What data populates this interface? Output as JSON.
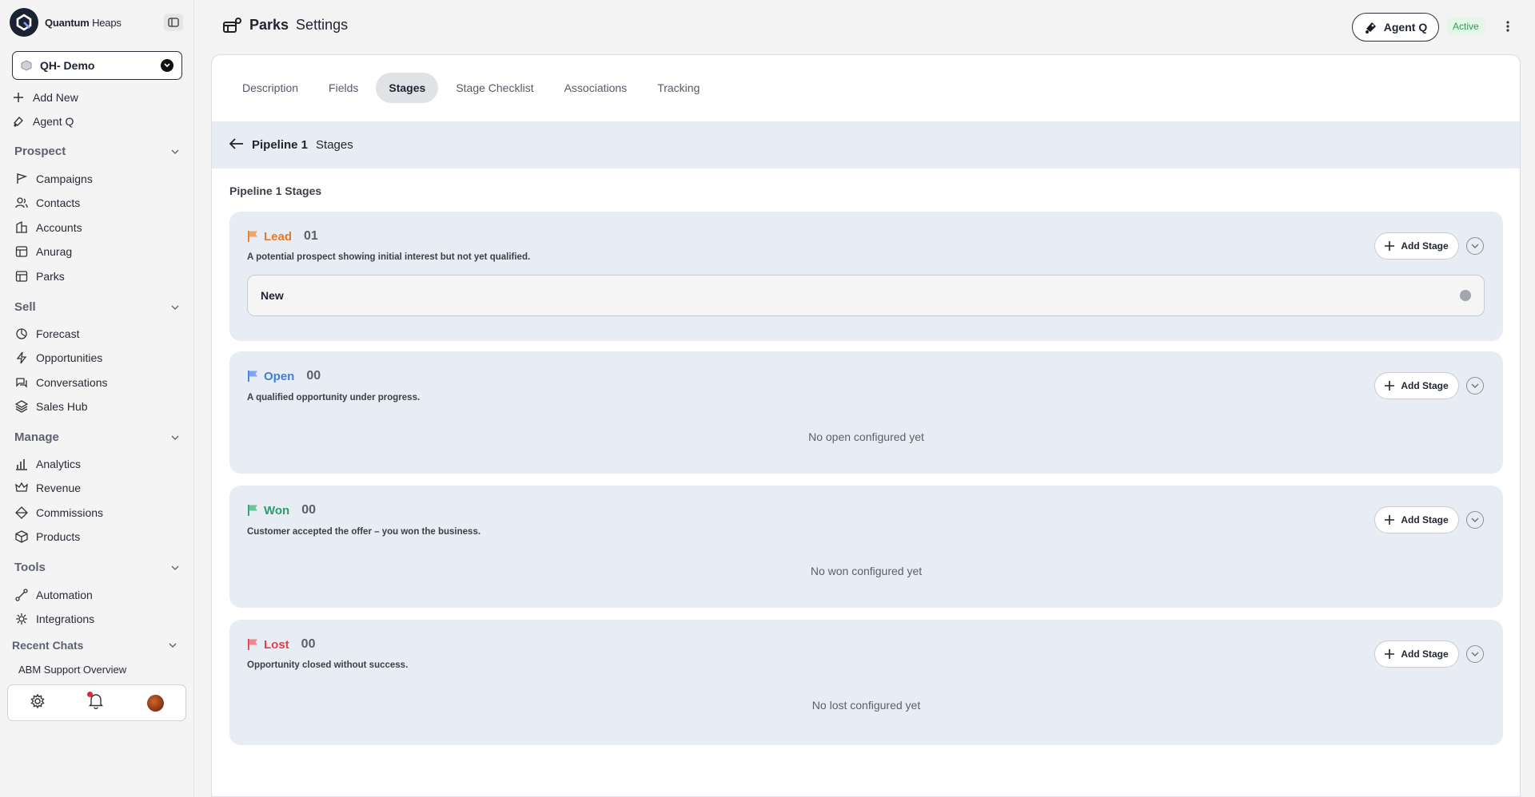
{
  "brand": {
    "name_bold": "Quantum",
    "name_light": "Heaps"
  },
  "workspace": {
    "name": "QH- Demo"
  },
  "quick_actions": [
    {
      "label": "Add New",
      "icon": "plus-icon"
    },
    {
      "label": "Agent Q",
      "icon": "agent-icon"
    }
  ],
  "sections": {
    "prospect": {
      "title": "Prospect",
      "items": [
        "Campaigns",
        "Contacts",
        "Accounts",
        "Anurag",
        "Parks"
      ]
    },
    "sell": {
      "title": "Sell",
      "items": [
        "Forecast",
        "Opportunities",
        "Conversations",
        "Sales Hub"
      ]
    },
    "manage": {
      "title": "Manage",
      "items": [
        "Analytics",
        "Revenue",
        "Commissions",
        "Products"
      ]
    },
    "tools": {
      "title": "Tools",
      "items": [
        "Automation",
        "Integrations"
      ]
    },
    "recent": {
      "title": "Recent Chats",
      "items": [
        "ABM Support Overview"
      ]
    }
  },
  "header": {
    "object": "Parks",
    "page": "Settings",
    "agent_label": "Agent Q",
    "status": "Active"
  },
  "tabs": [
    "Description",
    "Fields",
    "Stages",
    "Stage Checklist",
    "Associations",
    "Tracking"
  ],
  "active_tab": "Stages",
  "subheader": {
    "pipeline": "Pipeline 1",
    "suffix": "Stages"
  },
  "stages_label": "Pipeline 1 Stages",
  "add_stage_label": "Add Stage",
  "stage_groups": [
    {
      "name": "Lead",
      "count": "01",
      "color": "#e07b2c",
      "description": "A potential prospect showing initial interest but not yet qualified.",
      "stages": [
        "New"
      ],
      "empty": ""
    },
    {
      "name": "Open",
      "count": "00",
      "color": "#3f7fd9",
      "description": "A qualified opportunity under progress.",
      "stages": [],
      "empty": "No open configured yet"
    },
    {
      "name": "Won",
      "count": "00",
      "color": "#2f9a6a",
      "description": "Customer accepted the offer – you won the business.",
      "stages": [],
      "empty": "No won configured yet"
    },
    {
      "name": "Lost",
      "count": "00",
      "color": "#e0404e",
      "description": "Opportunity closed without success.",
      "stages": [],
      "empty": "No lost configured yet"
    }
  ]
}
